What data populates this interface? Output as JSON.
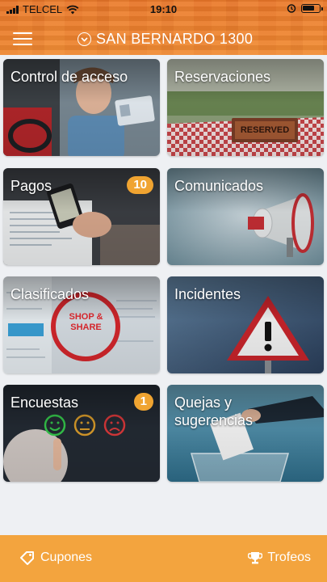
{
  "status_bar": {
    "carrier": "TELCEL",
    "time": "19:10"
  },
  "header": {
    "location": "SAN BERNARDO 1300"
  },
  "tiles": [
    {
      "label": "Control de acceso"
    },
    {
      "label": "Reservaciones",
      "sign": "RESERVED"
    },
    {
      "label": "Pagos",
      "badge": "10"
    },
    {
      "label": "Comunicados"
    },
    {
      "label": "Clasificados",
      "sign": "SHOP & SHARE"
    },
    {
      "label": "Incidentes"
    },
    {
      "label": "Encuestas",
      "badge": "1"
    },
    {
      "label": "Quejas y sugerencias"
    }
  ],
  "footer": {
    "left_label": "Cupones",
    "right_label": "Trofeos"
  },
  "colors": {
    "accent": "#f3a43e",
    "badge": "#f0a431"
  }
}
